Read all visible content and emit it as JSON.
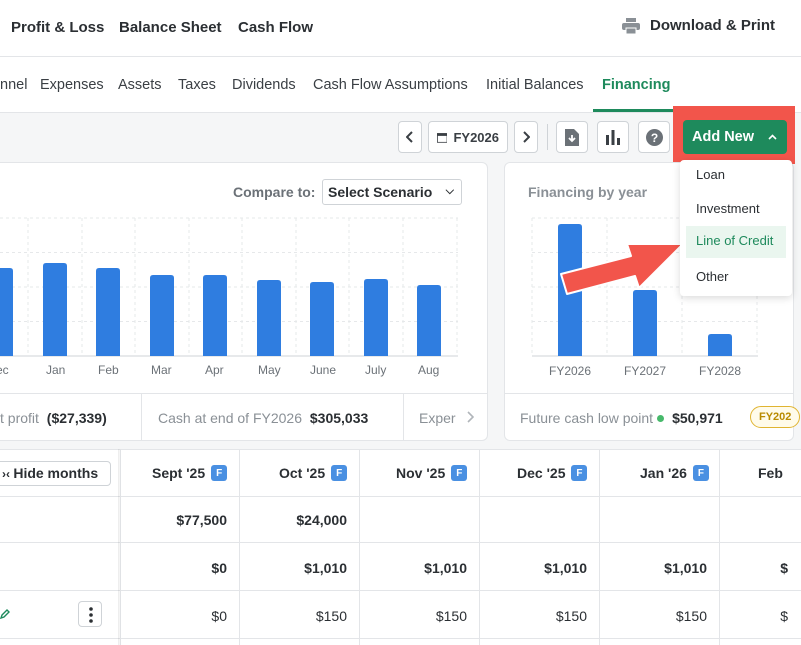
{
  "topnav": {
    "links": [
      "Profit & Loss",
      "Balance Sheet",
      "Cash Flow"
    ],
    "download_label": "Download & Print"
  },
  "tabs": [
    "nnel",
    "Expenses",
    "Assets",
    "Taxes",
    "Dividends",
    "Cash Flow Assumptions",
    "Initial Balances",
    "Financing"
  ],
  "active_tab": "Financing",
  "toolbar": {
    "year": "FY2026",
    "add_new_label": "Add New"
  },
  "add_menu": [
    "Loan",
    "Investment",
    "Line of Credit",
    "Other"
  ],
  "highlighted_item": "Line of Credit",
  "compare": {
    "label": "Compare to:",
    "select": "Select Scenario"
  },
  "monthly_chart": {
    "months": [
      "ec",
      "Jan",
      "Feb",
      "Mar",
      "Apr",
      "May",
      "June",
      "July",
      "Aug"
    ]
  },
  "yearly_chart": {
    "title": "Financing by year",
    "years": [
      "FY2026",
      "FY2027",
      "FY2028"
    ]
  },
  "chart_data": [
    {
      "type": "bar",
      "categories": [
        "ec",
        "Jan",
        "Feb",
        "Mar",
        "Apr",
        "May",
        "June",
        "July",
        "Aug"
      ],
      "values": [
        88,
        93,
        88,
        81,
        81,
        76,
        74,
        77,
        71
      ],
      "colors": [
        "#2f7de0"
      ]
    },
    {
      "type": "bar",
      "title": "Financing by year",
      "categories": [
        "FY2026",
        "FY2027",
        "FY2028"
      ],
      "values": [
        132,
        66,
        22
      ],
      "colors": [
        "#2f7de0"
      ]
    }
  ],
  "stats": {
    "net_profit_label": "t profit",
    "net_profit_value": "($27,339)",
    "cash_end_label": "Cash at end of FY2026",
    "cash_end_value": "$305,033",
    "exp_label": "Exper",
    "future_label": "Future cash low point",
    "future_value": "$50,971",
    "future_badge": "FY202"
  },
  "table": {
    "hide_label": "Hide months",
    "headers": [
      "Sept '25",
      "Oct '25",
      "Nov '25",
      "Dec '25",
      "Jan '26",
      "Feb"
    ],
    "forecast_badge": "F",
    "rows": [
      [
        "$77,500",
        "$24,000",
        "",
        "",
        "",
        ""
      ],
      [
        "$0",
        "$1,010",
        "$1,010",
        "$1,010",
        "$1,010",
        "$"
      ],
      [
        "$0",
        "$150",
        "$150",
        "$150",
        "$150",
        "$"
      ]
    ]
  },
  "colors": {
    "accent": "#1e8a5c",
    "bar": "#2f7de0",
    "highlight": "#f2554b"
  }
}
